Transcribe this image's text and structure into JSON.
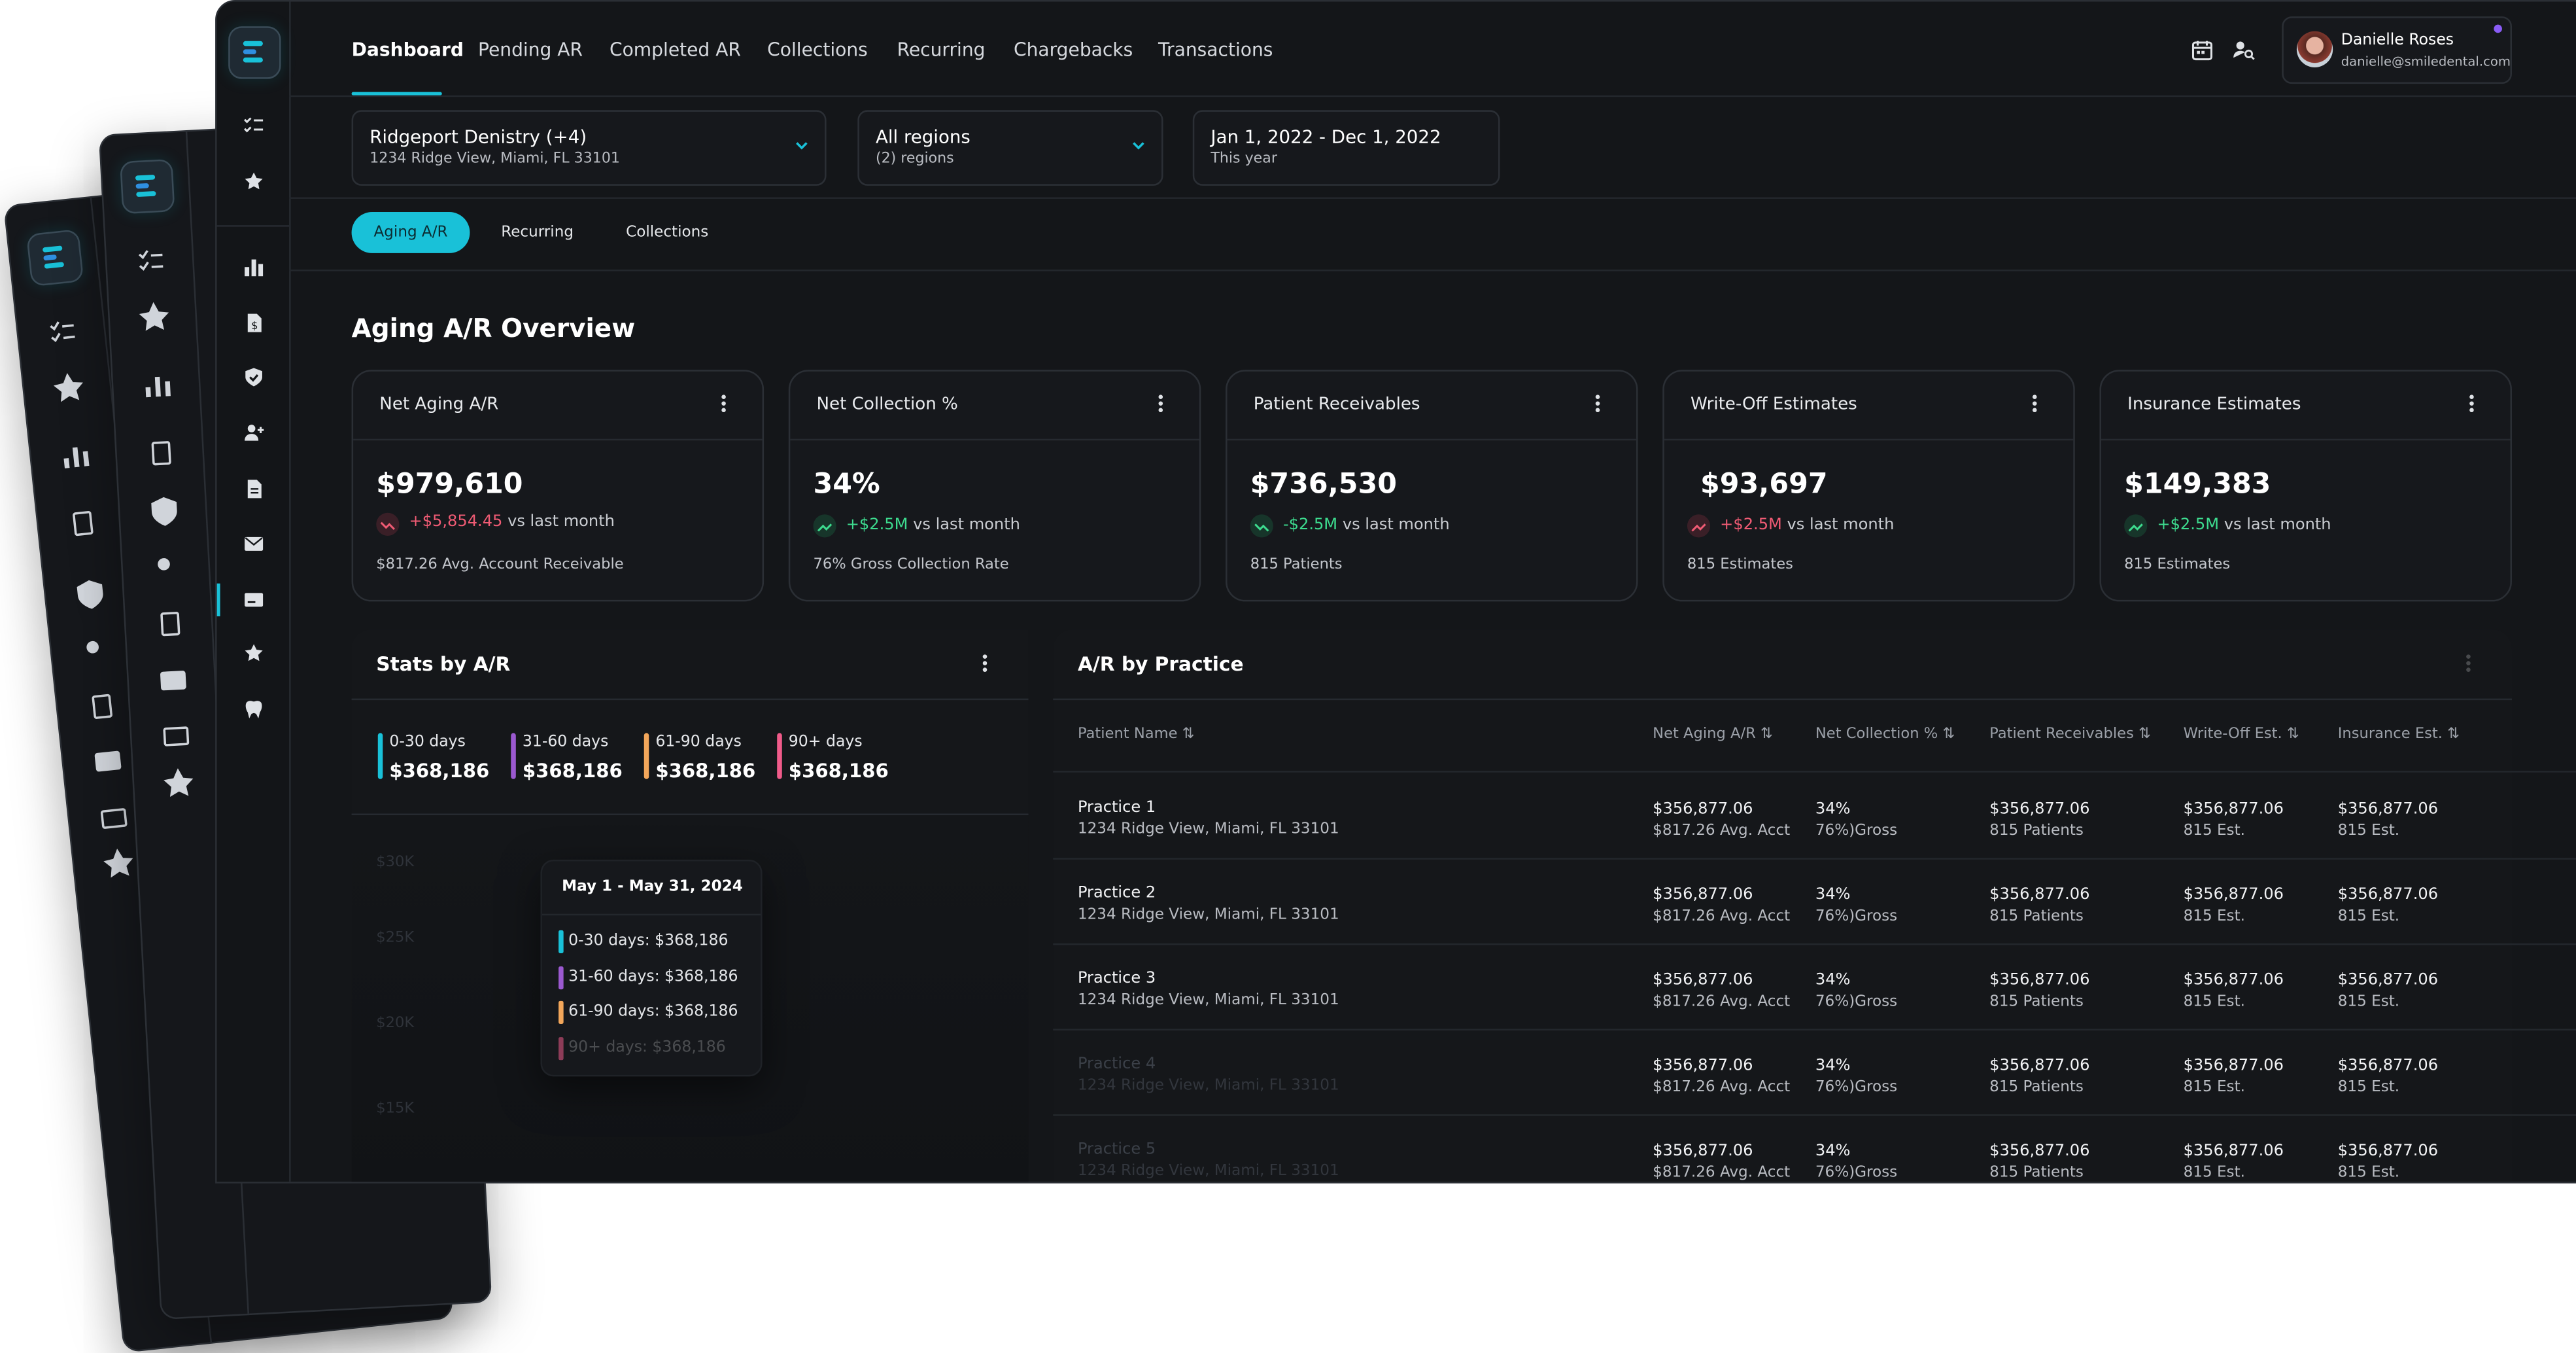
{
  "nav": {
    "tabs": [
      "Dashboard",
      "Pending AR",
      "Completed AR",
      "Collections",
      "Recurring",
      "Chargebacks",
      "Transactions"
    ],
    "active_index": 0
  },
  "user": {
    "name": "Danielle Roses",
    "email": "danielle@smiledental.com"
  },
  "filters": {
    "practice": {
      "title": "Ridgeport Denistry (+4)",
      "subtitle": "1234 Ridge View, Miami, FL 33101"
    },
    "region": {
      "title": "All regions",
      "subtitle": "(2) regions"
    },
    "date": {
      "title": "Jan 1, 2022 - Dec 1, 2022",
      "subtitle": "This year"
    }
  },
  "subtabs": [
    "Aging A/R",
    "Recurring",
    "Collections"
  ],
  "section_title": "Aging A/R Overview",
  "cards": [
    {
      "title": "Net Aging A/R",
      "value": "$979,610",
      "change": "+$5,854.45",
      "change_suffix": "vs last month",
      "trend": "down",
      "sub": "$817.26 Avg. Account Receivable"
    },
    {
      "title": "Net Collection %",
      "value": "34%",
      "change": "+$2.5M",
      "change_suffix": "vs last month",
      "trend": "up",
      "sub": "76% Gross Collection Rate"
    },
    {
      "title": "Patient Receivables",
      "value": "$736,530",
      "change": "-$2.5M",
      "change_suffix": "vs last month",
      "trend": "up",
      "sub": "815 Patients"
    },
    {
      "title": "Write-Off Estimates",
      "value": "$93,697",
      "change": "+$2.5M",
      "change_suffix": "vs last month",
      "trend": "down",
      "sub": "815 Estimates"
    },
    {
      "title": "Insurance Estimates",
      "value": "$149,383",
      "change": "+$2.5M",
      "change_suffix": "vs last month",
      "trend": "up",
      "sub": "815 Estimates"
    }
  ],
  "stats": {
    "title": "Stats by A/R",
    "items": [
      {
        "label": "0-30 days",
        "value": "$368,186",
        "color": "#19c1d8"
      },
      {
        "label": "31-60 days",
        "value": "$368,186",
        "color": "#9b59d0"
      },
      {
        "label": "61-90 days",
        "value": "$368,186",
        "color": "#f2a65a"
      },
      {
        "label": "90+ days",
        "value": "$368,186",
        "color": "#f05b8a"
      }
    ],
    "y_ticks": [
      "$30K",
      "$25K",
      "$20K",
      "$15K"
    ],
    "tooltip": {
      "title": "May 1 - May 31, 2024",
      "rows": [
        "0-30 days: $368,186",
        "31-60 days: $368,186",
        "61-90 days: $368,186",
        "90+ days: $368,186"
      ]
    }
  },
  "practice_table": {
    "title": "A/R by Practice",
    "columns": [
      "Patient Name",
      "Net Aging A/R",
      "Net Collection %",
      "Patient Receivables",
      "Write-Off Est.",
      "Insurance Est."
    ],
    "rows": [
      {
        "name": "Practice 1",
        "address": "1234 Ridge View, Miami, FL 33101",
        "c1": "$356,877.06",
        "c1s": "$817.26 Avg. Acct",
        "c2": "34%",
        "c2s": "76%)Gross",
        "c3": "$356,877.06",
        "c3s": "815 Patients",
        "c4": "$356,877.06",
        "c4s": "815 Est.",
        "c5": "$356,877.06",
        "c5s": "815 Est."
      },
      {
        "name": "Practice 2",
        "address": "1234 Ridge View, Miami, FL 33101",
        "c1": "$356,877.06",
        "c1s": "$817.26 Avg. Acct",
        "c2": "34%",
        "c2s": "76%)Gross",
        "c3": "$356,877.06",
        "c3s": "815 Patients",
        "c4": "$356,877.06",
        "c4s": "815 Est.",
        "c5": "$356,877.06",
        "c5s": "815 Est."
      },
      {
        "name": "Practice 3",
        "address": "1234 Ridge View, Miami, FL 33101",
        "c1": "$356,877.06",
        "c1s": "$817.26 Avg. Acct",
        "c2": "34%",
        "c2s": "76%)Gross",
        "c3": "$356,877.06",
        "c3s": "815 Patients",
        "c4": "$356,877.06",
        "c4s": "815 Est.",
        "c5": "$356,877.06",
        "c5s": "815 Est."
      },
      {
        "name": "Practice 4",
        "address": "1234 Ridge View, Miami, FL 33101",
        "c1": "$356,877.06",
        "c1s": "$817.26 Avg. Acct",
        "c2": "34%",
        "c2s": "76%)Gross",
        "c3": "$356,877.06",
        "c3s": "815 Patients",
        "c4": "$356,877.06",
        "c4s": "815 Est.",
        "c5": "$356,877.06",
        "c5s": "815 Est."
      },
      {
        "name": "Practice 5",
        "address": "1234 Ridge View, Miami, FL 33101",
        "c1": "$356,877.06",
        "c1s": "$817.26 Avg. Acct",
        "c2": "34%",
        "c2s": "76%)Gross",
        "c3": "$356,877.06",
        "c3s": "815 Patients",
        "c4": "$356,877.06",
        "c4s": "815 Est.",
        "c5": "$356,877.06",
        "c5s": "815 Est."
      }
    ]
  },
  "colors": {
    "accent": "#19c1d8",
    "panel": "#141619",
    "positive": "#3ddc8f",
    "negative": "#f05b74"
  },
  "icons": {
    "sidebar": [
      "logo",
      "checklist-icon",
      "star-icon",
      "bar-chart-icon",
      "dollar-doc-icon",
      "shield-check-icon",
      "user-plus-icon",
      "document-icon",
      "mail-icon",
      "card-icon",
      "star-icon",
      "tooth-icon"
    ],
    "header": [
      "calendar-icon",
      "user-search-icon"
    ]
  }
}
